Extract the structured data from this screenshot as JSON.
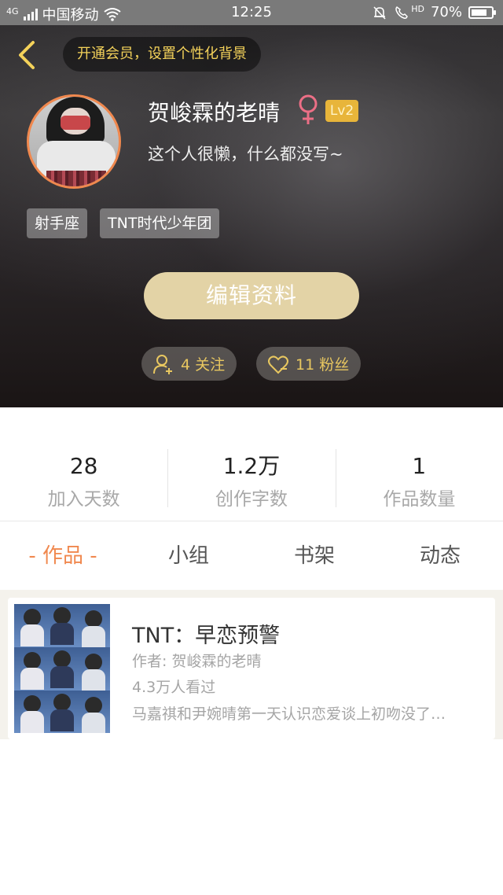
{
  "status_bar": {
    "network": "4G",
    "carrier": "中国移动",
    "time": "12:25",
    "hd_label": "HD",
    "battery": "70%",
    "battery_level": 0.7
  },
  "header": {
    "vip_prompt": "开通会员，设置个性化背景"
  },
  "profile": {
    "nickname": "贺峻霖的老晴",
    "gender_symbol": "♀",
    "level": "Lv2",
    "signature": "这个人很懒，什么都没写~",
    "tags": [
      "射手座",
      "TNT时代少年团"
    ],
    "edit_label": "编辑资料",
    "following_label": "4 关注",
    "fans_label": "11 粉丝"
  },
  "stats": [
    {
      "value": "28",
      "label": "加入天数"
    },
    {
      "value": "1.2万",
      "label": "创作字数"
    },
    {
      "value": "1",
      "label": "作品数量"
    }
  ],
  "tabs": [
    {
      "label": "- 作品 -",
      "active": true
    },
    {
      "label": "小组",
      "active": false
    },
    {
      "label": "书架",
      "active": false
    },
    {
      "label": "动态",
      "active": false
    }
  ],
  "works": [
    {
      "title": "TNT：早恋预警",
      "author": "作者: 贺峻霖的老晴",
      "views": "4.3万人看过",
      "description": "马嘉祺和尹婉晴第一天认识恋爱谈上初吻没了…"
    }
  ],
  "colors": {
    "accent": "#f0884e",
    "gold": "#e8c760",
    "edit_button": "#e3d3a6",
    "level_badge": "#e8b53a"
  }
}
